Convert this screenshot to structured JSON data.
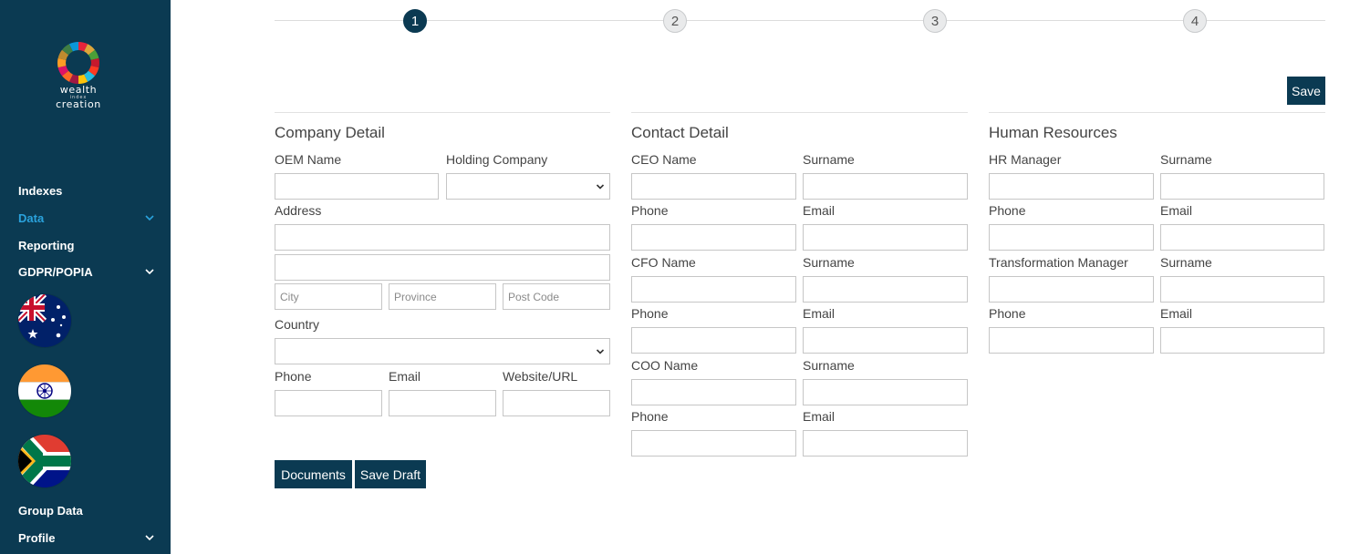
{
  "brand": {
    "line1": "wealth",
    "line2": "index",
    "line3": "creation"
  },
  "sidebar": {
    "items": [
      {
        "label": "Indexes",
        "has_chevron": false
      },
      {
        "label": "Data",
        "has_chevron": true,
        "active": true
      },
      {
        "label": "Reporting",
        "has_chevron": false
      },
      {
        "label": "GDPR/POPIA",
        "has_chevron": true
      }
    ],
    "flags": [
      "australia-flag",
      "india-flag",
      "south-africa-flag"
    ],
    "bottom_items": [
      {
        "label": "Group Data",
        "has_chevron": false
      },
      {
        "label": "Profile",
        "has_chevron": true
      }
    ]
  },
  "stepper": {
    "steps": [
      "1",
      "2",
      "3",
      "4"
    ],
    "active": 1
  },
  "actions": {
    "save": "Save",
    "documents": "Documents",
    "save_draft": "Save Draft"
  },
  "company": {
    "title": "Company Detail",
    "oem_name": "OEM Name",
    "holding_company": "Holding Company",
    "address": "Address",
    "city_placeholder": "City",
    "province_placeholder": "Province",
    "postcode_placeholder": "Post Code",
    "country": "Country",
    "phone": "Phone",
    "email": "Email",
    "website": "Website/URL"
  },
  "contact": {
    "title": "Contact Detail",
    "ceo_name": "CEO Name",
    "cfo_name": "CFO Name",
    "coo_name": "COO Name",
    "surname": "Surname",
    "phone": "Phone",
    "email": "Email"
  },
  "hr": {
    "title": "Human Resources",
    "hr_manager": "HR Manager",
    "transformation_manager": "Transformation Manager",
    "surname": "Surname",
    "phone": "Phone",
    "email": "Email"
  },
  "colors": {
    "primary": "#0b3a52",
    "active_nav": "#2aa2dc",
    "border": "#c6c6c6"
  }
}
